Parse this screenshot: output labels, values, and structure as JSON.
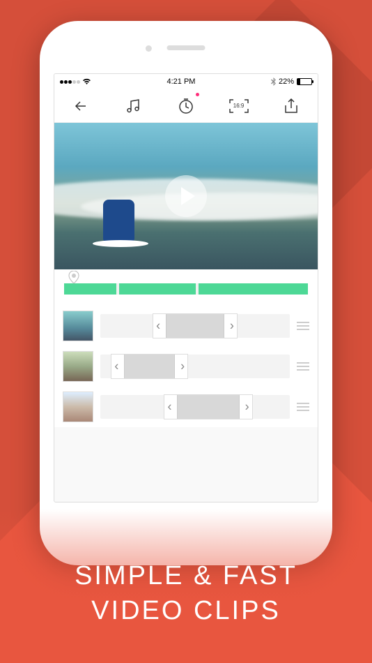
{
  "promo": {
    "line1": "SIMPLE & FAST",
    "line2": "VIDEO CLIPS"
  },
  "statusbar": {
    "time": "4:21 PM",
    "battery_pct": "22%"
  },
  "toolbar": {
    "back": "Back",
    "music": "Music",
    "timer": "Timer",
    "aspect_label": "16:9",
    "share": "Share"
  },
  "clips": [
    {
      "id": "clip-1"
    },
    {
      "id": "clip-2"
    },
    {
      "id": "clip-3"
    }
  ],
  "colors": {
    "accent": "#e8563f",
    "track": "#4dd896"
  }
}
